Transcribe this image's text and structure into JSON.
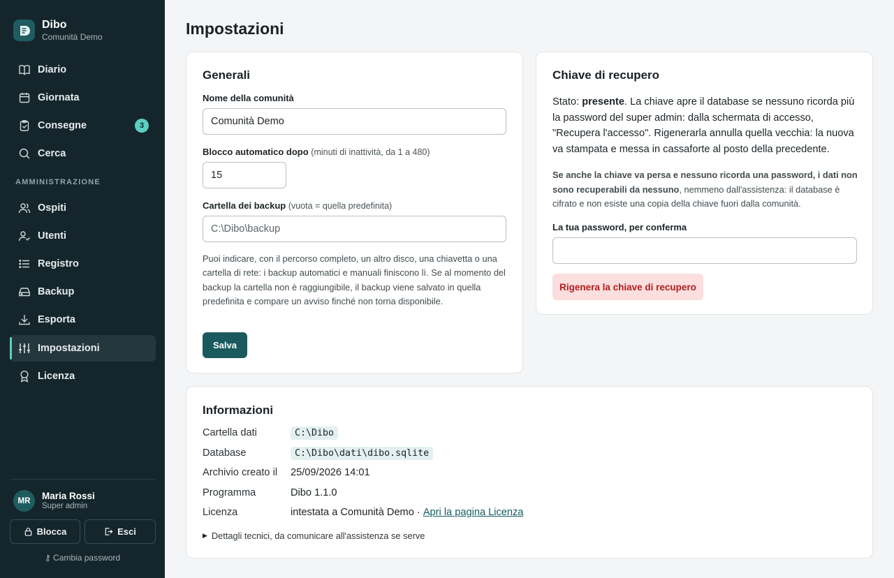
{
  "app": {
    "name": "Dibo",
    "community": "Comunità Demo"
  },
  "nav": {
    "diario": "Diario",
    "giornata": "Giornata",
    "consegne": "Consegne",
    "consegne_badge": "3",
    "cerca": "Cerca",
    "section_admin": "AMMINISTRAZIONE",
    "ospiti": "Ospiti",
    "utenti": "Utenti",
    "registro": "Registro",
    "backup": "Backup",
    "esporta": "Esporta",
    "impostazioni": "Impostazioni",
    "licenza": "Licenza"
  },
  "user": {
    "initials": "MR",
    "name": "Maria Rossi",
    "role": "Super admin",
    "lock_label": "Blocca",
    "logout_label": "Esci",
    "change_password": "Cambia password"
  },
  "page": {
    "title": "Impostazioni"
  },
  "generali": {
    "title": "Generali",
    "name_label": "Nome della comunità",
    "name_value": "Comunità Demo",
    "lock_label": "Blocco automatico dopo",
    "lock_hint": "(minuti di inattività, da 1 a 480)",
    "lock_value": "15",
    "backup_label": "Cartella dei backup",
    "backup_hint": "(vuota = quella predefinita)",
    "backup_placeholder": "C:\\Dibo\\backup",
    "help": "Puoi indicare, con il percorso completo, un altro disco, una chiavetta o una cartella di rete: i backup automatici e manuali finiscono lì. Se al momento del backup la cartella non è raggiungibile, il backup viene salvato in quella predefinita e compare un avviso finché non torna disponibile.",
    "save_label": "Salva"
  },
  "recovery": {
    "title": "Chiave di recupero",
    "status_prefix": "Stato: ",
    "status_value": "presente",
    "status_text": ". La chiave apre il database se nessuno ricorda più la password del super admin: dalla schermata di accesso, \"Recupera l'accesso\". Rigenerarla annulla quella vecchia: la nuova va stampata e messa in cassaforte al posto della precedente.",
    "warn_bold": "Se anche la chiave va persa e nessuno ricorda una password, i dati non sono recuperabili da nessuno",
    "warn_rest": ", nemmeno dall'assistenza: il database è cifrato e non esiste una copia della chiave fuori dalla comunità.",
    "password_label": "La tua password, per conferma",
    "password_value": "",
    "regen_label": "Rigenera la chiave di recupero"
  },
  "info": {
    "title": "Informazioni",
    "data_folder_key": "Cartella dati",
    "data_folder_value": "C:\\Dibo",
    "database_key": "Database",
    "database_value": "C:\\Dibo\\dati\\dibo.sqlite",
    "created_key": "Archivio creato il",
    "created_value": "25/09/2026 14:01",
    "program_key": "Programma",
    "program_value": "Dibo 1.1.0",
    "license_key": "Licenza",
    "license_value": "intestata a Comunità Demo · ",
    "license_link": "Apri la pagina Licenza",
    "details_label": "Dettagli tecnici, da comunicare all'assistenza se serve"
  }
}
